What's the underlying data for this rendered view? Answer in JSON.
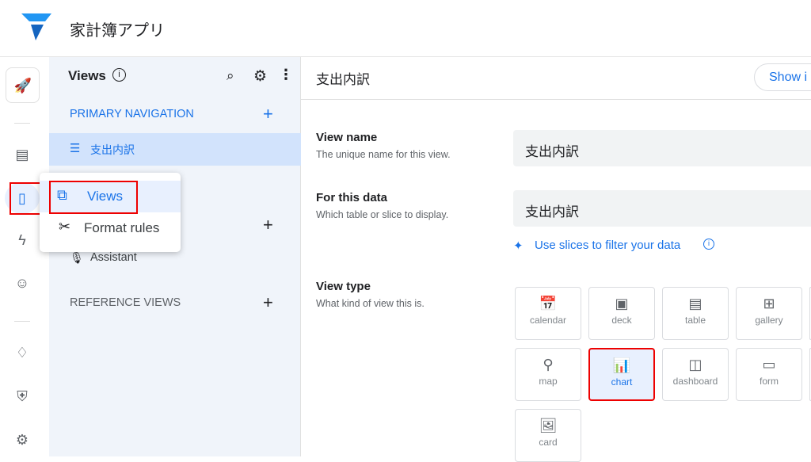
{
  "header": {
    "app_title": "家計簿アプリ",
    "logo": "appsheet-logo"
  },
  "rail": {
    "icons": [
      "rocket-icon",
      "table-icon",
      "phone-icon",
      "bolt-icon",
      "robot-icon",
      "bulb-icon",
      "shield-icon",
      "gear-icon"
    ]
  },
  "sidebar": {
    "title": "Views",
    "primary_nav": "PRIMARY NAVIGATION",
    "primary_items": [
      {
        "label": "支出内訳",
        "icon": "list-icon"
      }
    ],
    "assistant": "Assistant",
    "reference_views": "REFERENCE VIEWS"
  },
  "popup": {
    "items": [
      {
        "label": "Views",
        "icon": "views-icon",
        "active": true
      },
      {
        "label": "Format rules",
        "icon": "format-rules-icon"
      }
    ]
  },
  "main": {
    "title": "支出内訳",
    "show_button": "Show i",
    "view_name": {
      "label": "View name",
      "help": "The unique name for this view.",
      "value": "支出内訳"
    },
    "for_data": {
      "label": "For this data",
      "help": "Which table or slice to display.",
      "value": "支出内訳"
    },
    "slices_link": "Use slices to filter your data",
    "view_type": {
      "label": "View type",
      "help": "What kind of view this is.",
      "selected": "chart",
      "options": [
        "calendar",
        "deck",
        "table",
        "gallery",
        "map",
        "chart",
        "dashboard",
        "form",
        "card"
      ]
    }
  },
  "colors": {
    "accent": "#1a73e8",
    "highlight_box": "#e00000",
    "sidebar_bg": "#f0f4fa"
  }
}
